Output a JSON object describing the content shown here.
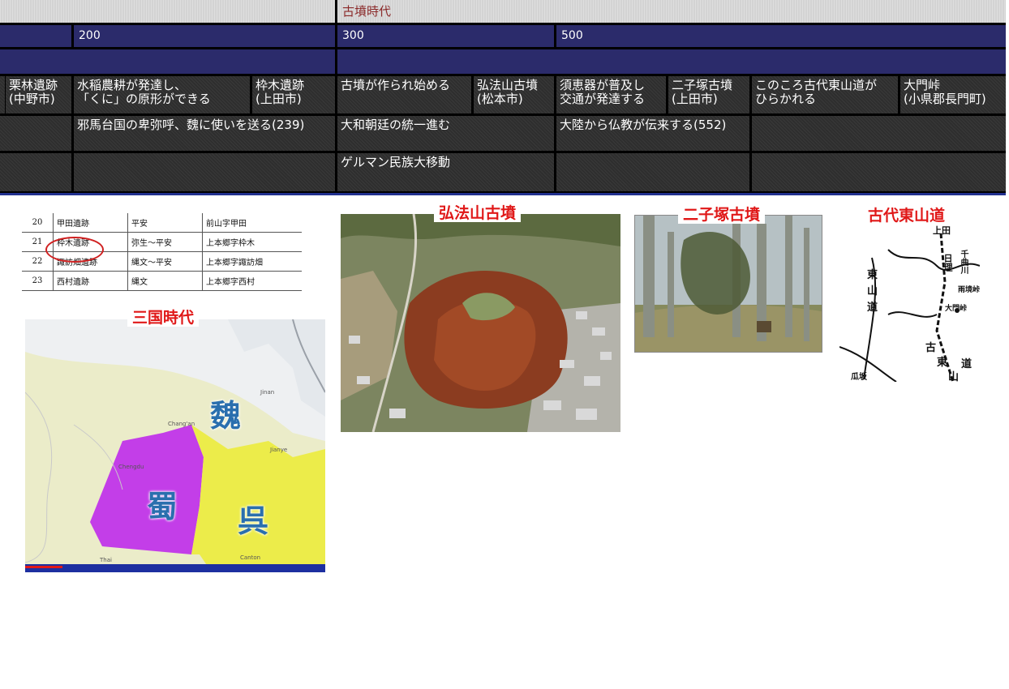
{
  "timeline": {
    "era_label": "古墳時代",
    "years": [
      "200",
      "300",
      "500"
    ],
    "events_row1": [
      {
        "line1": "栗林遺跡",
        "line2": "(中野市)"
      },
      {
        "line1": "水稲農耕が発達し、",
        "line2": "「くに」の原形ができる"
      },
      {
        "line1": "枠木遺跡",
        "line2": "(上田市)"
      },
      {
        "line1": "古墳が作られ始める",
        "line2": ""
      },
      {
        "line1": "弘法山古墳",
        "line2": "(松本市)"
      },
      {
        "line1": "須恵器が普及し",
        "line2": "交通が発達する"
      },
      {
        "line1": "二子塚古墳",
        "line2": "(上田市)"
      },
      {
        "line1": "このころ古代東山道が",
        "line2": "ひらかれる"
      },
      {
        "line1": "大門峠",
        "line2": "(小県郡長門町)"
      }
    ],
    "events_row2": [
      "邪馬台国の卑弥呼、魏に使いを送る(239)",
      "大和朝廷の統一進む",
      "大陸から仏教が伝来する(552)"
    ],
    "events_row3": [
      "ゲルマン民族大移動"
    ]
  },
  "site_table": {
    "rows": [
      {
        "no": "20",
        "name": "甲田遺跡",
        "period": "平安",
        "place": "前山字甲田"
      },
      {
        "no": "21",
        "name": "枠木遺跡",
        "period": "弥生～平安",
        "place": "上本郷字枠木"
      },
      {
        "no": "22",
        "name": "諏訪畑遺跡",
        "period": "縄文～平安",
        "place": "上本郷字諏訪畑"
      },
      {
        "no": "23",
        "name": "西村遺跡",
        "period": "縄文",
        "place": "上本郷字西村"
      }
    ]
  },
  "captions": {
    "three_kingdoms": "三国時代",
    "kobosan": "弘法山古墳",
    "futagozuka": "二子塚古墳",
    "tosando": "古代東山道"
  },
  "map3": {
    "wei": "魏",
    "shu": "蜀",
    "wu": "呉",
    "cities": [
      "Chang'an",
      "Chengdu",
      "Jianye",
      "Canton",
      "Jinan",
      "Thai"
    ]
  },
  "oldmap": {
    "labels": [
      "上田",
      "日理",
      "東",
      "山",
      "道",
      "千曲川",
      "大門峠",
      "雨境峠",
      "瓜坂",
      "古",
      "東",
      "山",
      "道"
    ]
  },
  "colors": {
    "era_bg": "#d3d3d3",
    "year_bg": "#2b2b6b",
    "event_bg": "#2e2e2e",
    "caption_red": "#e01818",
    "wei_blue": "#2a6fae",
    "shu_purple": "#c33ee8",
    "wu_yellow": "#ecec4a"
  }
}
